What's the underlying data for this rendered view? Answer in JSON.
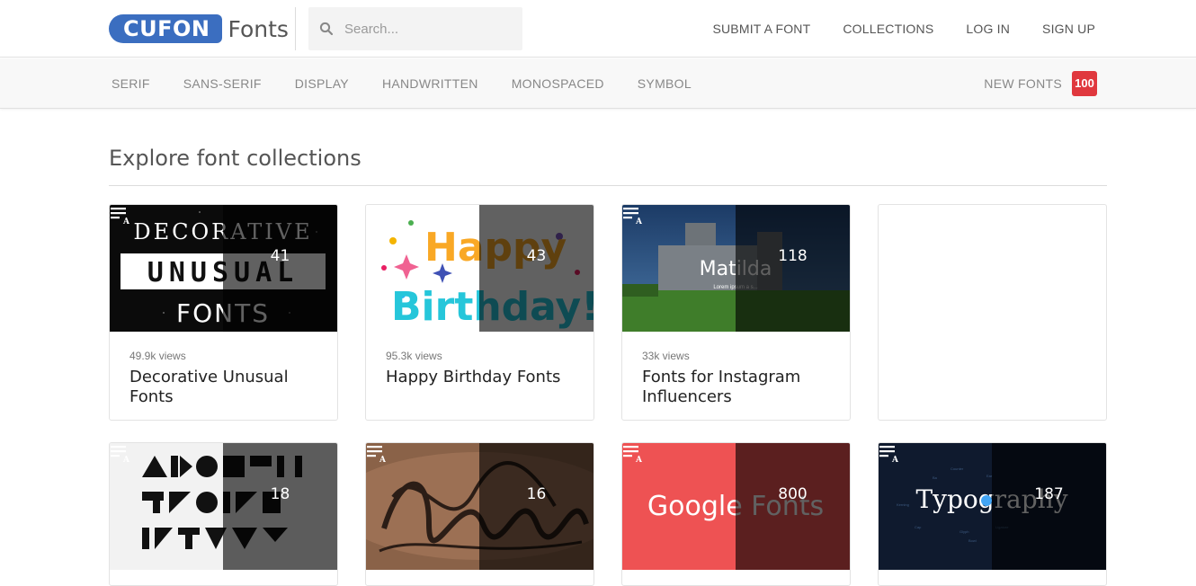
{
  "header": {
    "logo_badge": "CUFON",
    "logo_word": "Fonts",
    "search_placeholder": "Search...",
    "nav": [
      "SUBMIT A FONT",
      "COLLECTIONS",
      "LOG IN",
      "SIGN UP"
    ]
  },
  "categories": [
    "SERIF",
    "SANS-SERIF",
    "DISPLAY",
    "HANDWRITTEN",
    "MONOSPACED",
    "SYMBOL"
  ],
  "new_fonts": {
    "label": "NEW FONTS",
    "count": "100"
  },
  "main": {
    "title": "Explore font collections",
    "collections": [
      {
        "count": "41",
        "views": "49.9k views",
        "name": "Decorative Unusual Fonts",
        "thumb": "decorative"
      },
      {
        "count": "43",
        "views": "95.3k views",
        "name": "Happy Birthday Fonts",
        "thumb": "birthday"
      },
      {
        "count": "118",
        "views": "33k views",
        "name": "Fonts for Instagram Influencers",
        "thumb": "castle"
      },
      {
        "count": "",
        "views": "",
        "name": "",
        "thumb": "empty"
      },
      {
        "count": "18",
        "views": "",
        "name": "",
        "thumb": "geometric"
      },
      {
        "count": "16",
        "views": "",
        "name": "",
        "thumb": "tattoo"
      },
      {
        "count": "800",
        "views": "",
        "name": "",
        "thumb": "google"
      },
      {
        "count": "187",
        "views": "",
        "name": "",
        "thumb": "typography"
      }
    ],
    "thumb_text": {
      "decorative": [
        "DECORATIVE",
        "UNUSUAL",
        "FONTS"
      ],
      "birthday": [
        "Happy",
        "Birthday!"
      ],
      "castle": [
        "Matilda",
        "Lorem ipsum a s..."
      ],
      "google": [
        "Google Fonts"
      ],
      "typography": [
        "Typography"
      ]
    }
  },
  "colors": {
    "accent": "#3b6ec0",
    "badge": "#e0383e",
    "google_red": "#ee5253",
    "navy": "#0f1a2e"
  }
}
